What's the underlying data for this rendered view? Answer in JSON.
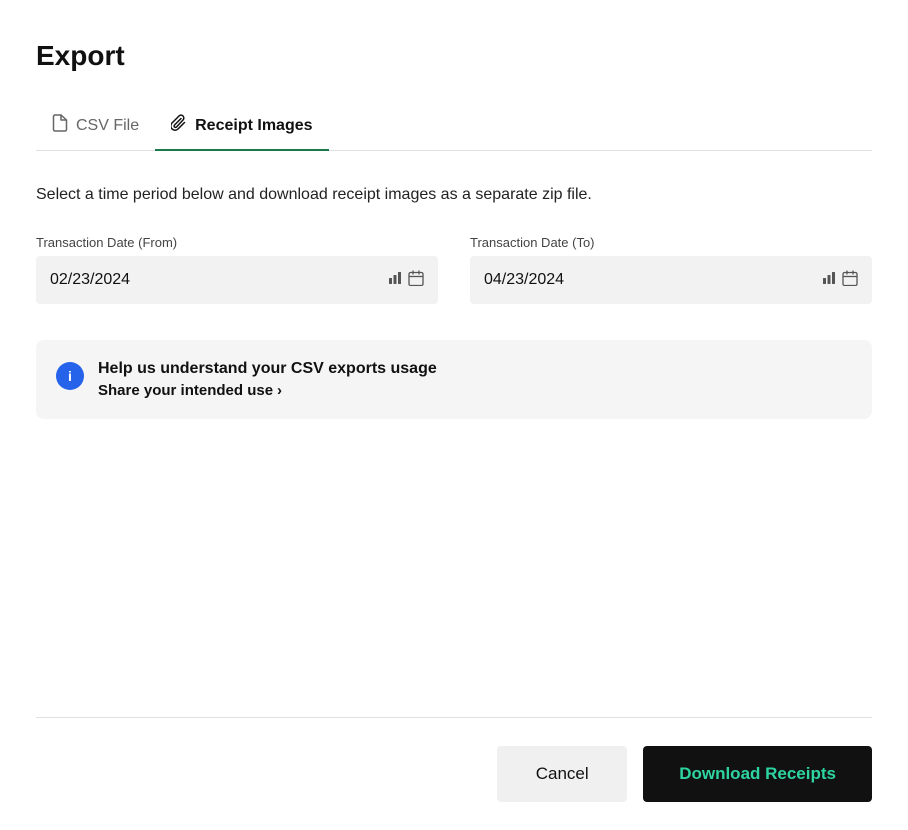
{
  "modal": {
    "title": "Export",
    "tabs": [
      {
        "id": "csv",
        "label": "CSV File",
        "icon": "file-icon",
        "active": false
      },
      {
        "id": "receipt",
        "label": "Receipt Images",
        "icon": "paperclip-icon",
        "active": true
      }
    ],
    "body": {
      "description": "Select a time period below and download receipt images as a separate zip file.",
      "date_from": {
        "label": "Transaction Date (From)",
        "value": "02/23/2024"
      },
      "date_to": {
        "label": "Transaction Date (To)",
        "value": "04/23/2024"
      },
      "info_box": {
        "title": "Help us understand your CSV exports usage",
        "link_label": "Share your intended use",
        "link_arrow": "›"
      }
    },
    "footer": {
      "cancel_label": "Cancel",
      "download_label": "Download Receipts"
    }
  },
  "colors": {
    "active_tab_underline": "#1a7a4a",
    "download_btn_bg": "#111111",
    "download_btn_text": "#2dd4a0",
    "info_icon_bg": "#2563eb"
  }
}
